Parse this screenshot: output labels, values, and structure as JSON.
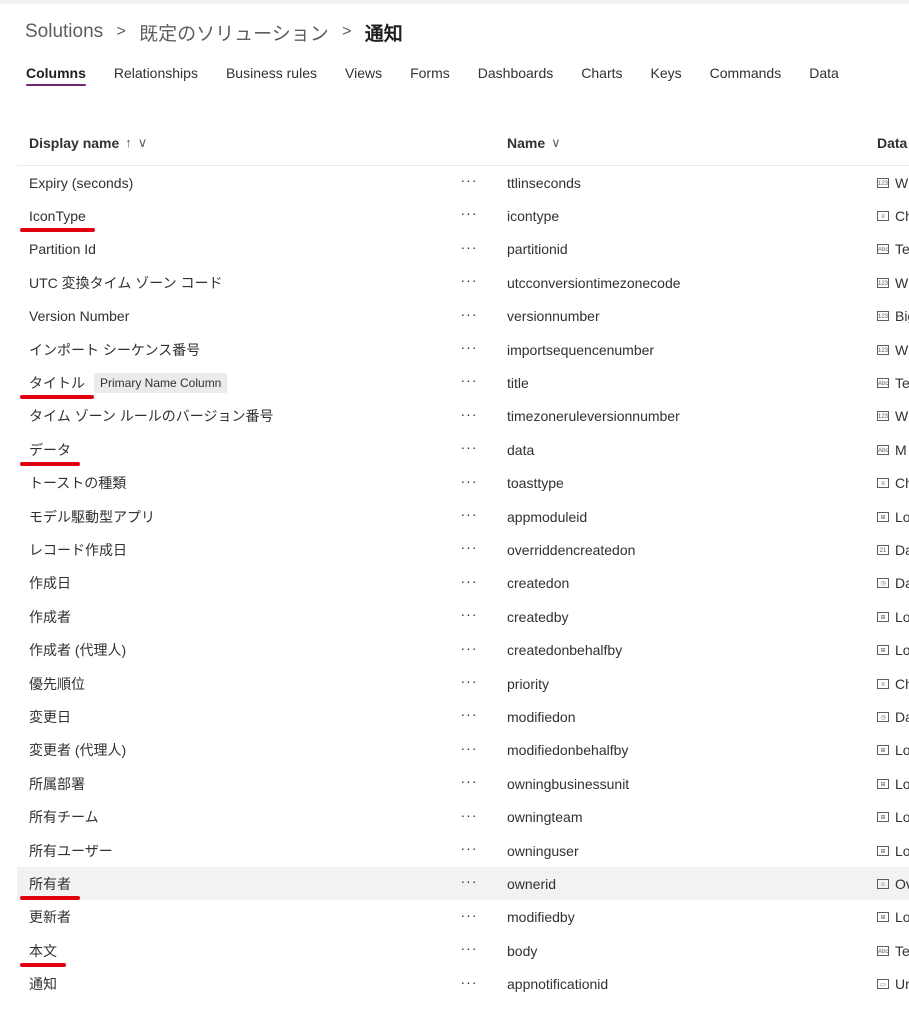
{
  "breadcrumb": {
    "items": [
      "Solutions",
      "既定のソリューション",
      "通知"
    ],
    "separator": ">"
  },
  "tabs": [
    {
      "label": "Columns",
      "active": true
    },
    {
      "label": "Relationships"
    },
    {
      "label": "Business rules"
    },
    {
      "label": "Views"
    },
    {
      "label": "Forms"
    },
    {
      "label": "Dashboards"
    },
    {
      "label": "Charts"
    },
    {
      "label": "Keys"
    },
    {
      "label": "Commands"
    },
    {
      "label": "Data"
    }
  ],
  "columns": {
    "display_name": "Display name",
    "sort_glyph": "↑",
    "chevron": "∨",
    "name": "Name",
    "data_type": "Data"
  },
  "rows": [
    {
      "display": "Expiry (seconds)",
      "name": "ttlinseconds",
      "type": "W",
      "icon": "number-icon"
    },
    {
      "display": "IconType",
      "name": "icontype",
      "type": "Ch",
      "icon": "choice-icon",
      "marked": true
    },
    {
      "display": "Partition Id",
      "name": "partitionid",
      "type": "Te",
      "icon": "text-icon"
    },
    {
      "display": "UTC 変換タイム ゾーン コード",
      "name": "utcconversiontimezonecode",
      "type": "W",
      "icon": "number-icon"
    },
    {
      "display": "Version Number",
      "name": "versionnumber",
      "type": "Big",
      "icon": "number-icon"
    },
    {
      "display": "インポート シーケンス番号",
      "name": "importsequencenumber",
      "type": "W",
      "icon": "number-icon"
    },
    {
      "display": "タイトル",
      "badge": "Primary Name Column",
      "name": "title",
      "type": "Te",
      "icon": "text-icon",
      "marked": true
    },
    {
      "display": "タイム ゾーン ルールのバージョン番号",
      "name": "timezoneruleversionnumber",
      "type": "W",
      "icon": "number-icon"
    },
    {
      "display": "データ",
      "name": "data",
      "type": "M",
      "icon": "multiline-icon",
      "marked": true
    },
    {
      "display": "トーストの種類",
      "name": "toasttype",
      "type": "Ch",
      "icon": "choice-icon"
    },
    {
      "display": "モデル駆動型アプリ",
      "name": "appmoduleid",
      "type": "Lo",
      "icon": "lookup-icon"
    },
    {
      "display": "レコード作成日",
      "name": "overriddencreatedon",
      "type": "Da",
      "icon": "date-icon"
    },
    {
      "display": "作成日",
      "name": "createdon",
      "type": "Da",
      "icon": "datetime-icon"
    },
    {
      "display": "作成者",
      "name": "createdby",
      "type": "Lo",
      "icon": "lookup-icon"
    },
    {
      "display": "作成者 (代理人)",
      "name": "createdonbehalfby",
      "type": "Lo",
      "icon": "lookup-icon"
    },
    {
      "display": "優先順位",
      "name": "priority",
      "type": "Ch",
      "icon": "choice-icon"
    },
    {
      "display": "変更日",
      "name": "modifiedon",
      "type": "Da",
      "icon": "datetime-icon"
    },
    {
      "display": "変更者 (代理人)",
      "name": "modifiedonbehalfby",
      "type": "Lo",
      "icon": "lookup-icon"
    },
    {
      "display": "所属部署",
      "name": "owningbusinessunit",
      "type": "Lo",
      "icon": "lookup-icon"
    },
    {
      "display": "所有チーム",
      "name": "owningteam",
      "type": "Lo",
      "icon": "lookup-icon"
    },
    {
      "display": "所有ユーザー",
      "name": "owninguser",
      "type": "Lo",
      "icon": "lookup-icon"
    },
    {
      "display": "所有者",
      "name": "ownerid",
      "type": "Ov",
      "icon": "person-icon",
      "marked": true,
      "selected": true
    },
    {
      "display": "更新者",
      "name": "modifiedby",
      "type": "Lo",
      "icon": "lookup-icon"
    },
    {
      "display": "本文",
      "name": "body",
      "type": "Te",
      "icon": "text-icon",
      "marked": true
    },
    {
      "display": "通知",
      "name": "appnotificationid",
      "type": "Ur",
      "icon": "unique-id-icon"
    }
  ],
  "more_glyph": "···",
  "icon_glyphs": {
    "number-icon": "123",
    "choice-icon": "≡",
    "text-icon": "Abc",
    "multiline-icon": "Abc",
    "lookup-icon": "⊞",
    "date-icon": "21",
    "datetime-icon": "◷",
    "person-icon": "☺",
    "unique-id-icon": "▭"
  },
  "colors": {
    "accent": "#742774",
    "annotation": "#e00010",
    "selected_row": "#f3f2f1"
  }
}
